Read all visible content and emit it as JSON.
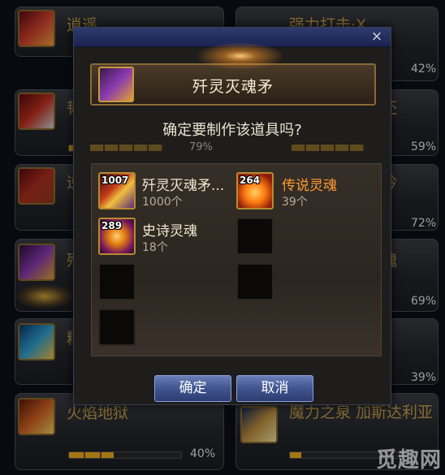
{
  "background": {
    "cards": [
      {
        "title": "逍遥",
        "pct": ""
      },
      {
        "title": "强力打击·X",
        "pct": "42%"
      },
      {
        "title": "韧",
        "pct": ""
      },
      {
        "title": "还",
        "pct": "59%"
      },
      {
        "title": "逆",
        "pct": ""
      },
      {
        "title": "吟",
        "pct": "72%"
      },
      {
        "title": "歼",
        "pct": ""
      },
      {
        "title": "魂",
        "pct": "69%"
      },
      {
        "title": "精",
        "pct": ""
      },
      {
        "title": "",
        "pct": "39%"
      },
      {
        "title": "火焰地狱",
        "pct": "40%"
      },
      {
        "title": "魔力之泉 加斯达利亚",
        "pct": ""
      }
    ],
    "bar_fill": {
      "c0": 0.0,
      "c1": 0.42,
      "c2": 0.0,
      "c3": 0.59,
      "c4": 0.0,
      "c5": 0.72,
      "c6": 0.0,
      "c7": 0.69,
      "c8": 0.0,
      "c9": 0.39,
      "c10": 0.4
    }
  },
  "dialog": {
    "close_icon": "×",
    "item_name": "歼灵灭魂矛",
    "question": "确定要制作该道具吗?",
    "hidden_pct": "79%",
    "materials": [
      {
        "count": "1007",
        "name": "歼灵灭魂矛...",
        "qty": "1000个",
        "icon": "spear-icon",
        "name_color": "#f2e8d0"
      },
      {
        "count": "264",
        "name": "传说灵魂",
        "qty": "39个",
        "icon": "legendary-soul-icon",
        "name_color": "#ff9a30"
      },
      {
        "count": "289",
        "name": "史诗灵魂",
        "qty": "18个",
        "icon": "epic-soul-icon",
        "name_color": "#f2e8d0"
      }
    ],
    "confirm_label": "确定",
    "cancel_label": "取消"
  },
  "watermark": "觅趣网",
  "colors": {
    "accent_gold": "#c99a3a",
    "button_blue": "#3f548f",
    "legend_orange": "#ff9a30"
  }
}
